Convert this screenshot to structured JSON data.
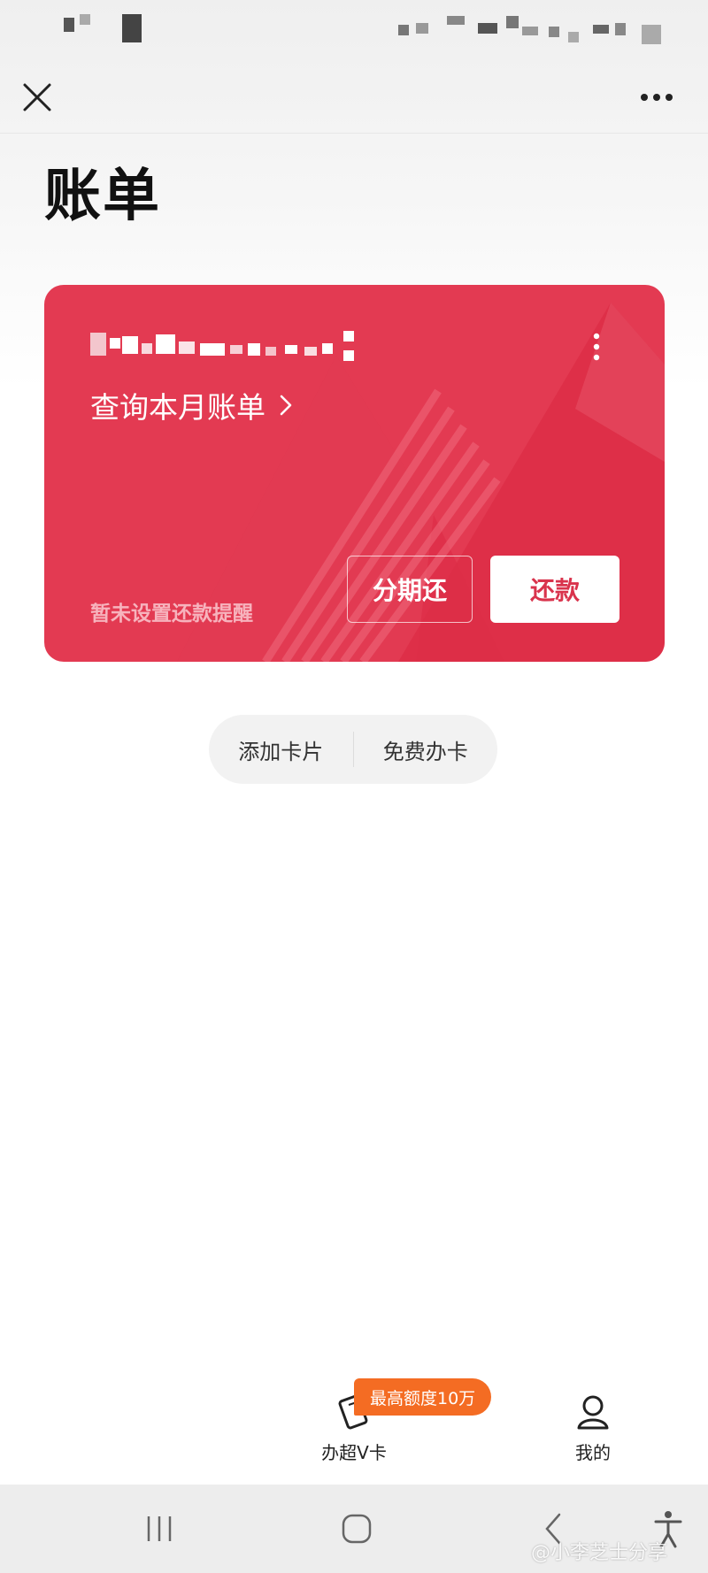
{
  "colors": {
    "card_red": "#e33a52",
    "repay_text": "#d9334c",
    "promo_orange": "#f46c23",
    "title_text": "#111111"
  },
  "nav": {
    "close_icon": "close-icon",
    "more_icon": "more-horizontal-icon"
  },
  "page": {
    "title": "账单"
  },
  "card": {
    "query_label": "查询本月账单",
    "reminder": "暂未设置还款提醒",
    "installment_button": "分期还",
    "repay_button": "还款",
    "more_icon": "more-vertical-icon"
  },
  "actions": {
    "add_card": "添加卡片",
    "free_apply": "免费办卡"
  },
  "tabbar": {
    "promo_badge": "最高额度10万",
    "tab_card": "办超V卡",
    "tab_mine": "我的"
  },
  "system_nav": {
    "recent_icon": "recent-apps-icon",
    "home_icon": "home-icon",
    "back_icon": "back-icon",
    "accessibility_icon": "accessibility-icon"
  },
  "watermark": "@小李芝士分享"
}
